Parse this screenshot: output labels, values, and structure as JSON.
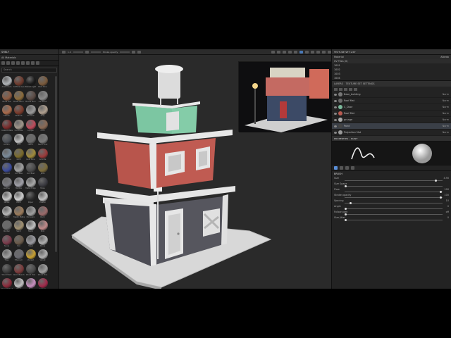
{
  "shelf": {
    "title": "SHELF",
    "tab": "All Materials",
    "search_placeholder": "Search",
    "materials": [
      {
        "name": "Aluminium",
        "color": "#b0b4b8"
      },
      {
        "name": "Artificial Lea",
        "color": "#6e3a2c"
      },
      {
        "name": "Baked Light",
        "color": "#1a1a1a"
      },
      {
        "name": "Bark Pine",
        "color": "#7a5a3c"
      },
      {
        "name": "Bone Tile",
        "color": "#8c5a40"
      },
      {
        "name": "Brass Worn",
        "color": "#8a6a3a"
      },
      {
        "name": "Bricks Ston",
        "color": "#5a4a44"
      },
      {
        "name": "Car Paint",
        "color": "#8a8a8a"
      },
      {
        "name": "Carbon",
        "color": "#a86a4a"
      },
      {
        "name": "Ceramic",
        "color": "#7a3a2a"
      },
      {
        "name": "Chrome",
        "color": "#9a9a9a"
      },
      {
        "name": "Clay",
        "color": "#b0a090"
      },
      {
        "name": "Coated Metal",
        "color": "#7a2a2a"
      },
      {
        "name": "Concrete",
        "color": "#a0968a"
      },
      {
        "name": "Copper",
        "color": "#c04a5a"
      },
      {
        "name": "Cork",
        "color": "#8a6a54"
      },
      {
        "name": "Denim",
        "color": "#4a4e54"
      },
      {
        "name": "Dirt",
        "color": "#c0c0c0"
      },
      {
        "name": "Fabric",
        "color": "#6a6a6a"
      },
      {
        "name": "Fabric Knit",
        "color": "#7a7a7a"
      },
      {
        "name": "Fiberglass",
        "color": "#7a8a9a"
      },
      {
        "name": "Gold",
        "color": "#7a6a2a"
      },
      {
        "name": "Gold Pure",
        "color": "#a08a3a"
      },
      {
        "name": "Granite",
        "color": "#9a3a3a"
      },
      {
        "name": "Ground",
        "color": "#3a4a9a"
      },
      {
        "name": "Iron Raw",
        "color": "#a0a0a0"
      },
      {
        "name": "Iron Rust",
        "color": "#4a4a4a"
      },
      {
        "name": "Jade",
        "color": "#7a6a3a"
      },
      {
        "name": "Leather",
        "color": "#7a7a80"
      },
      {
        "name": "Marble",
        "color": "#a0a0a8"
      },
      {
        "name": "Metal Edge",
        "color": "#a8a8a8"
      },
      {
        "name": "Moss",
        "color": "#3a3a40"
      },
      {
        "name": "Nickel",
        "color": "#c8c8c8"
      },
      {
        "name": "Paint",
        "color": "#d0d0d0"
      },
      {
        "name": "Paper",
        "color": "#2a2a2a"
      },
      {
        "name": "Plaster",
        "color": "#c0c0c0"
      },
      {
        "name": "Plastic",
        "color": "#b8b8b8"
      },
      {
        "name": "Plastic Matte",
        "color": "#9a7a5a"
      },
      {
        "name": "Porcelain",
        "color": "#a0a0a0"
      },
      {
        "name": "Rock",
        "color": "#9a6a6a"
      },
      {
        "name": "Rubber",
        "color": "#6a6a6a"
      },
      {
        "name": "Sand",
        "color": "#a09070"
      },
      {
        "name": "Silver",
        "color": "#c0c0c0"
      },
      {
        "name": "Skin",
        "color": "#c08a8a"
      },
      {
        "name": "Snow",
        "color": "#7a3a4a"
      },
      {
        "name": "Soil",
        "color": "#6a5a4a"
      },
      {
        "name": "Steel",
        "color": "#9a9aa0"
      },
      {
        "name": "Stone",
        "color": "#b0b0b0"
      },
      {
        "name": "Tiles",
        "color": "#a0a0a0"
      },
      {
        "name": "Titanium",
        "color": "#6a6a70"
      },
      {
        "name": "Varnish",
        "color": "#c8a030"
      },
      {
        "name": "Velvet",
        "color": "#b0b0b0"
      },
      {
        "name": "Wood Bark",
        "color": "#3a3a3a"
      },
      {
        "name": "Wood Beech",
        "color": "#7a3a3a"
      },
      {
        "name": "Wood Oak",
        "color": "#4a4a4a"
      },
      {
        "name": "Wood Pine",
        "color": "#a0a0a0"
      },
      {
        "name": "Wood Walnut",
        "color": "#8a2a3a"
      },
      {
        "name": "Wool",
        "color": "#c0c0c0"
      },
      {
        "name": "Zinc",
        "color": "#c890c0"
      },
      {
        "name": "Leaves",
        "color": "#a02a4a"
      },
      {
        "name": "Lava",
        "color": "#8a8a8a"
      },
      {
        "name": "Ice",
        "color": "#d0d0d0"
      },
      {
        "name": "Grass",
        "color": "#d89020"
      },
      {
        "name": "Glass",
        "color": "#3a3a3a"
      },
      {
        "name": "Gravel",
        "color": "#9a9a9a"
      },
      {
        "name": "Foam",
        "color": "#b0b0b0"
      },
      {
        "name": "Felt",
        "color": "#2a2a2a"
      },
      {
        "name": "Coal",
        "color": "#505050"
      },
      {
        "name": "Brick",
        "color": "#b0b0b0"
      },
      {
        "name": "Asphalt",
        "color": "#c8c8c8"
      }
    ]
  },
  "toolbar": {
    "size_label": "1.0",
    "flow_label": "Stroke opacity",
    "items": [
      "brush",
      "eraser",
      "projection",
      "smudge",
      "clone",
      "picker"
    ]
  },
  "texture_set_list": {
    "title": "TEXTURE SET LIST",
    "material_label": "Material",
    "uv_tiles": [
      "UV Tiles (0)",
      "1001",
      "1002",
      "1003",
      "1004"
    ],
    "sets_label": "Albedo"
  },
  "layers": {
    "tab_layers": "LAYERS",
    "tab_settings": "TEXTURE SET SETTINGS",
    "items": [
      {
        "name": "Base_building",
        "blend": "Norm",
        "thumb": "#777777",
        "selected": false
      },
      {
        "name": "Roof Mat",
        "blend": "Norm",
        "thumb": "#6a6a6a",
        "selected": false
      },
      {
        "name": "C_Door",
        "blend": "Norm",
        "thumb": "#7ab89a",
        "selected": false
      },
      {
        "name": "Roof Mat",
        "blend": "Norm",
        "thumb": "#b85a50",
        "selected": false
      },
      {
        "name": "grunge",
        "blend": "Norm",
        "thumb": "#aaaaaa",
        "selected": false
      },
      {
        "name": "Paint",
        "blend": "Norm",
        "thumb": "#444444",
        "selected": true
      },
      {
        "name": "Projection Mat",
        "blend": "Norm",
        "thumb": "#999999",
        "selected": false
      }
    ]
  },
  "properties": {
    "title": "PROPERTIES - PAINT",
    "section": "BRUSH",
    "sliders": [
      {
        "label": "Size",
        "value": "4.90",
        "fraction": 0.92
      },
      {
        "label": "Size Space",
        "value": "",
        "fraction": 0.0
      },
      {
        "label": "Flow",
        "value": "100",
        "fraction": 0.97
      },
      {
        "label": "Stroke opacity",
        "value": "100",
        "fraction": 0.97
      },
      {
        "label": "Spacing",
        "value": "10",
        "fraction": 0.05
      },
      {
        "label": "Angle",
        "value": "0",
        "fraction": 0.0
      },
      {
        "label": "Follow path",
        "value": "off",
        "fraction": 0.0
      },
      {
        "label": "Size Jitter",
        "value": "0",
        "fraction": 0.0
      }
    ]
  },
  "colors": {
    "accent": "#5a8fd8",
    "roof_green": "#7cc6a2",
    "wall_red": "#b8554c",
    "wall_dark": "#4e4e56",
    "trim": "#e6e6e6"
  }
}
